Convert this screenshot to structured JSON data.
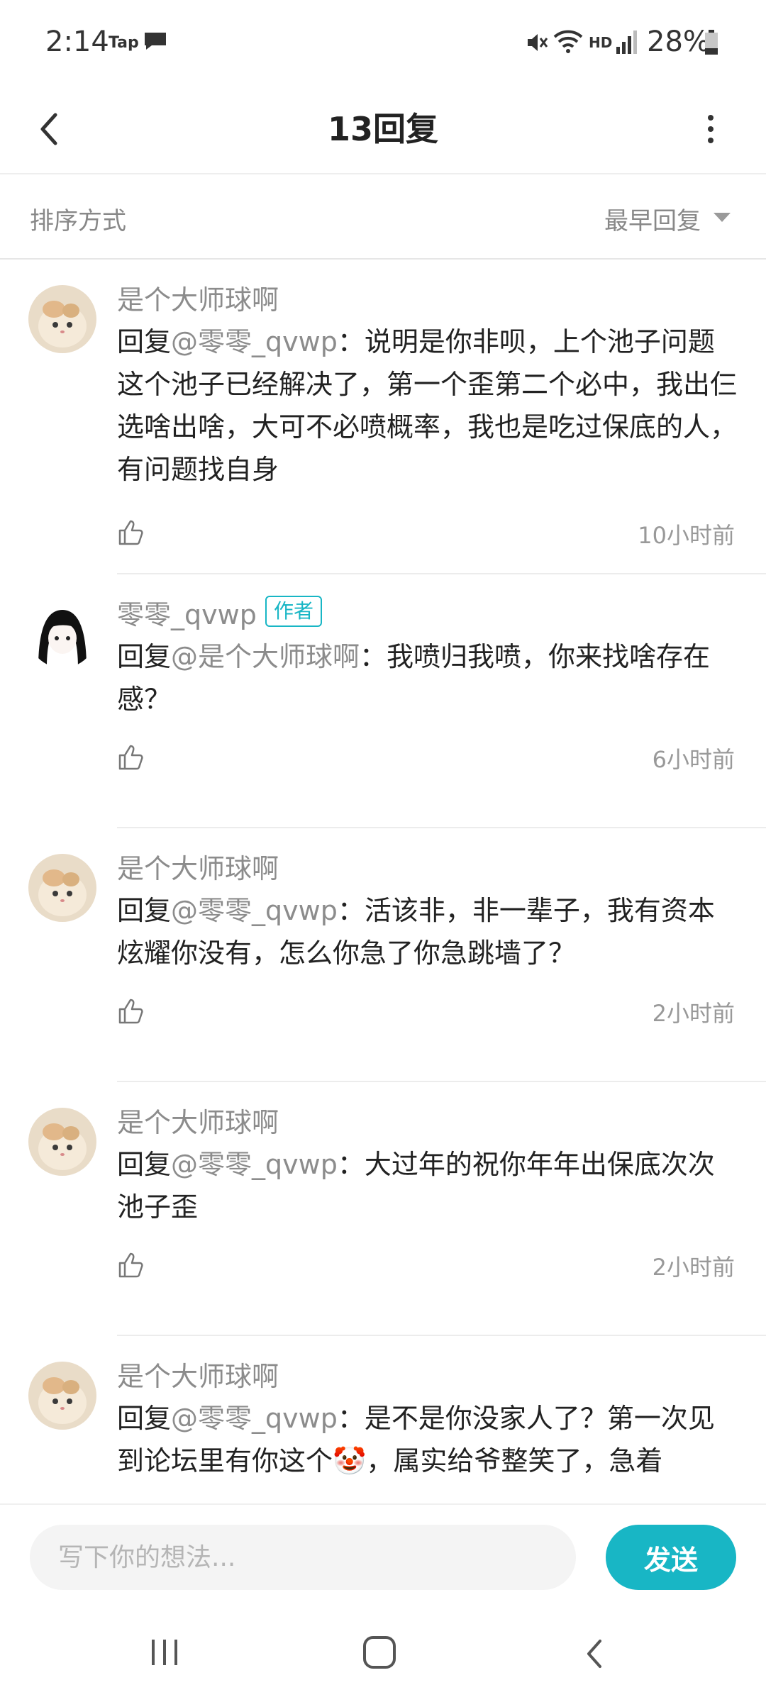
{
  "status_bar": {
    "time": "2:14",
    "tap_label": "Tap",
    "hd_label": "HD",
    "battery": "28%"
  },
  "header": {
    "title": "13回复"
  },
  "sort": {
    "label": "排序方式",
    "value": "最早回复"
  },
  "comments": [
    {
      "username": "是个大师球啊",
      "prefix": "回复",
      "mention": "@零零_qvwp",
      "text": "：说明是你非呗，上个池子问题这个池子已经解决了，第一个歪第二个必中，我出仨选啥出啥，大可不必喷概率，我也是吃过保底的人，有问题找自身",
      "time": "10小时前"
    },
    {
      "username": "零零_qvwp",
      "badge": "作者",
      "prefix": "回复",
      "mention": "@是个大师球啊",
      "text": "：我喷归我喷，你来找啥存在感？",
      "time": "6小时前"
    },
    {
      "username": "是个大师球啊",
      "prefix": "回复",
      "mention": "@零零_qvwp",
      "text": "：活该非，非一辈子，我有资本炫耀你没有，怎么你急了你急跳墙了？",
      "time": "2小时前"
    },
    {
      "username": "是个大师球啊",
      "prefix": "回复",
      "mention": "@零零_qvwp",
      "text": "：大过年的祝你年年出保底次次池子歪",
      "time": "2小时前"
    },
    {
      "username": "是个大师球啊",
      "prefix": "回复",
      "mention": "@零零_qvwp",
      "text": "：是不是你没家人了？第一次见到论坛里有你这个🤡，属实给爷整笑了，急着",
      "time": ""
    }
  ],
  "input": {
    "placeholder": "写下你的想法...",
    "send_label": "发送"
  },
  "colors": {
    "accent": "#18b6c5",
    "muted_text": "#8c8c8c"
  },
  "icons": {
    "back": "chevron-left-icon",
    "more": "more-vertical-icon",
    "like": "thumbs-up-icon",
    "sort": "caret-down-icon"
  }
}
